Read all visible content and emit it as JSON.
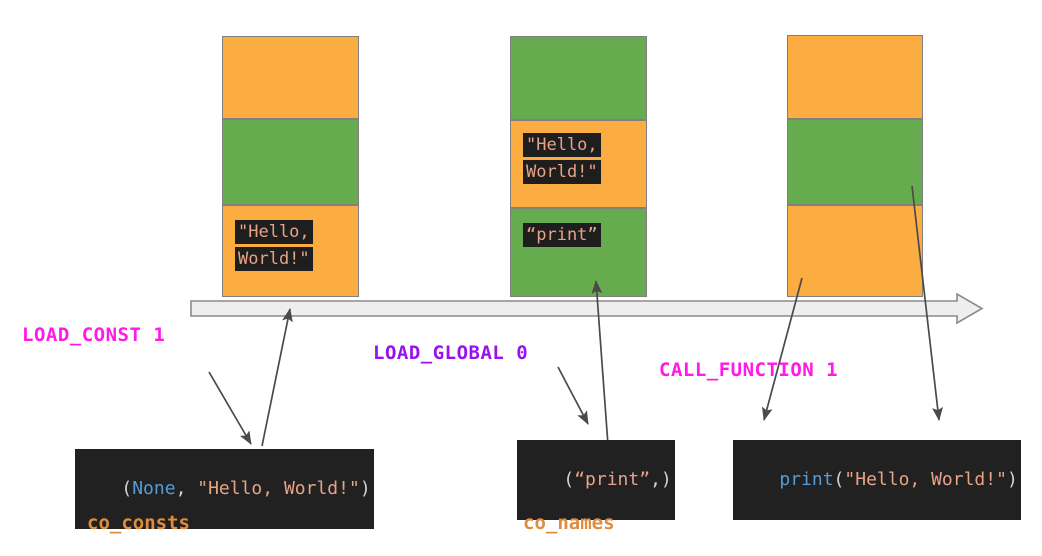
{
  "colors": {
    "orange": "#fbad41",
    "green": "#66ac4e",
    "cell_border": "#808080",
    "rail_fill": "#eeeeee",
    "rail_border": "#8a8a8a",
    "arrow": "#4a4a4a",
    "magenta": "#ff1ae6",
    "purple": "#9911ee",
    "caption_orange": "#e08c3c",
    "code_bg": "#212121",
    "code_string": "#e8a285",
    "code_keyword": "#569cd6",
    "code_punct": "#d4d4d4",
    "background": "#ffffff"
  },
  "stacks": [
    {
      "name": "load-const-stack",
      "cells": [
        {
          "color": "orange",
          "lines": []
        },
        {
          "color": "green",
          "lines": []
        },
        {
          "color": "orange",
          "lines": [
            "\"Hello,",
            "World!\""
          ]
        }
      ]
    },
    {
      "name": "load-global-stack",
      "cells": [
        {
          "color": "green",
          "lines": []
        },
        {
          "color": "orange",
          "lines": [
            "\"Hello,",
            "World!\""
          ]
        },
        {
          "color": "green",
          "lines": [
            "“print”"
          ]
        }
      ]
    },
    {
      "name": "call-function-stack",
      "cells": [
        {
          "color": "orange",
          "lines": []
        },
        {
          "color": "green",
          "lines": []
        },
        {
          "color": "orange",
          "lines": []
        }
      ]
    }
  ],
  "opcodes": [
    {
      "name": "load-const",
      "label": "LOAD_CONST 1",
      "color": "#ff1ae6"
    },
    {
      "name": "load-global",
      "label": "LOAD_GLOBAL 0",
      "color": "#9911ee"
    },
    {
      "name": "call-function",
      "label": "CALL_FUNCTION 1",
      "color": "#ff1ae6"
    }
  ],
  "code_snippets": {
    "co_consts_tuple": {
      "name": "co-consts-value",
      "tokens": [
        {
          "text": "(",
          "type": "punct"
        },
        {
          "text": "None",
          "type": "kw"
        },
        {
          "text": ", ",
          "type": "punct"
        },
        {
          "text": "\"Hello, World!\"",
          "type": "str"
        },
        {
          "text": ")",
          "type": "punct"
        }
      ]
    },
    "co_names_tuple": {
      "name": "co-names-value",
      "tokens": [
        {
          "text": "(",
          "type": "punct"
        },
        {
          "text": "“print”",
          "type": "str"
        },
        {
          "text": ",)",
          "type": "punct"
        }
      ]
    },
    "call_expression": {
      "name": "call-expression-value",
      "tokens": [
        {
          "text": "print",
          "type": "fn"
        },
        {
          "text": "(",
          "type": "punct"
        },
        {
          "text": "\"Hello, World!\"",
          "type": "str"
        },
        {
          "text": ")",
          "type": "punct"
        }
      ]
    }
  },
  "captions": [
    {
      "name": "co-consts-caption",
      "label": "co_consts"
    },
    {
      "name": "co-names-caption",
      "label": "co_names"
    }
  ],
  "rail": {
    "name": "execution-timeline",
    "direction": "right"
  }
}
